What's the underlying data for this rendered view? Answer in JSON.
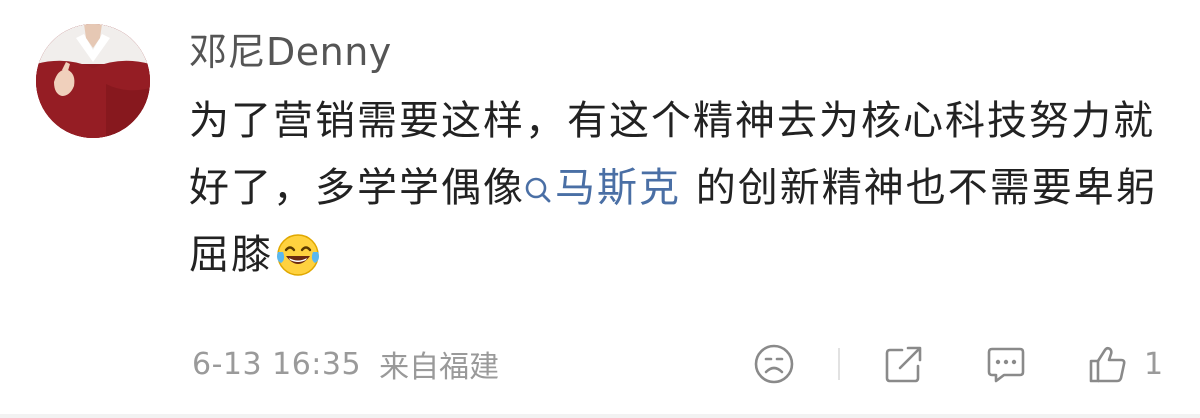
{
  "comment": {
    "username": "邓尼Denny",
    "text_before": "为了营销需要这样，有这个精神去为核心科技努力就好了，多学学偶像",
    "mention": "马斯克",
    "text_after": " 的创新精神也不需要卑躬屈膝",
    "emoji": "laughing-tears-emoji",
    "timestamp": "6-13 16:35",
    "location": "来自福建",
    "like_count": "1"
  },
  "icons": {
    "reaction": "smiley-icon",
    "repost": "share-icon",
    "reply": "comment-icon",
    "like": "thumbs-up-icon"
  },
  "colors": {
    "mention": "#4a6fa5",
    "meta_text": "#9a9a9a",
    "avatar_bg": "#8d1a20"
  }
}
